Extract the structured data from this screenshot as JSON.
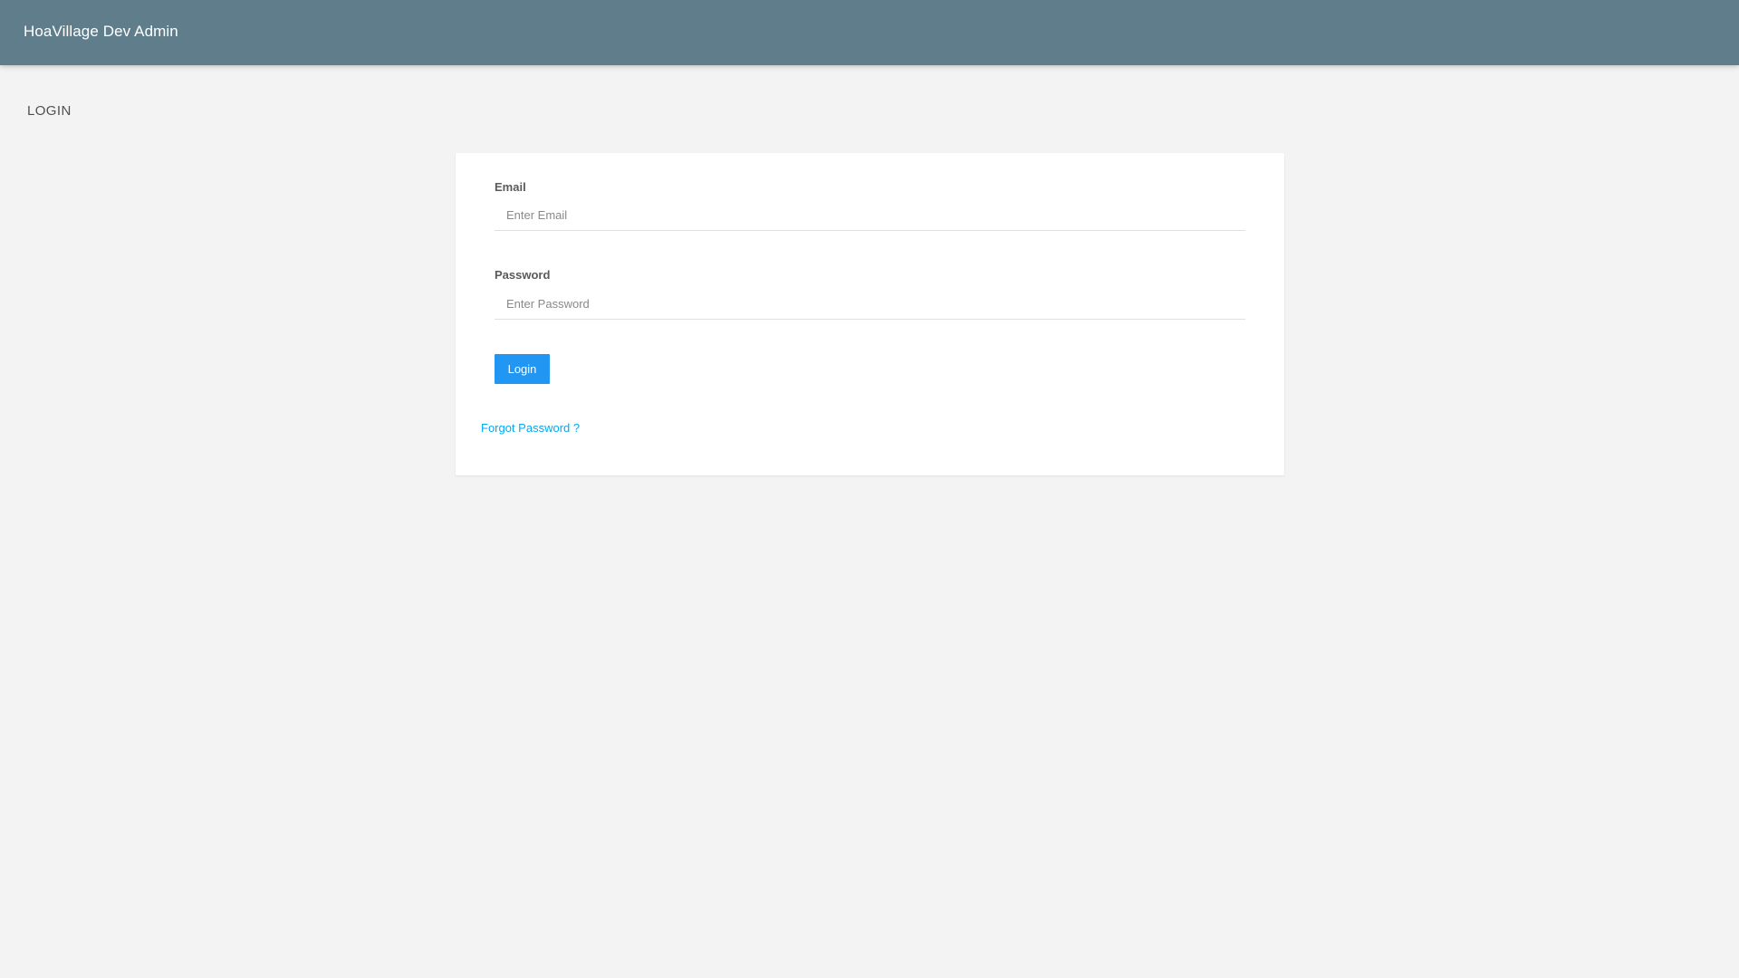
{
  "header": {
    "title": "HoaVillage Dev Admin"
  },
  "page": {
    "title": "LOGIN"
  },
  "form": {
    "email": {
      "label": "Email",
      "placeholder": "Enter Email",
      "value": ""
    },
    "password": {
      "label": "Password",
      "placeholder": "Enter Password",
      "value": ""
    },
    "login_label": "Login",
    "forgot_label": "Forgot Password ?"
  },
  "colors": {
    "header_bg": "#607d8b",
    "page_bg": "#f3f3f3",
    "button_bg": "#2196f3",
    "link": "#03a9f4"
  }
}
